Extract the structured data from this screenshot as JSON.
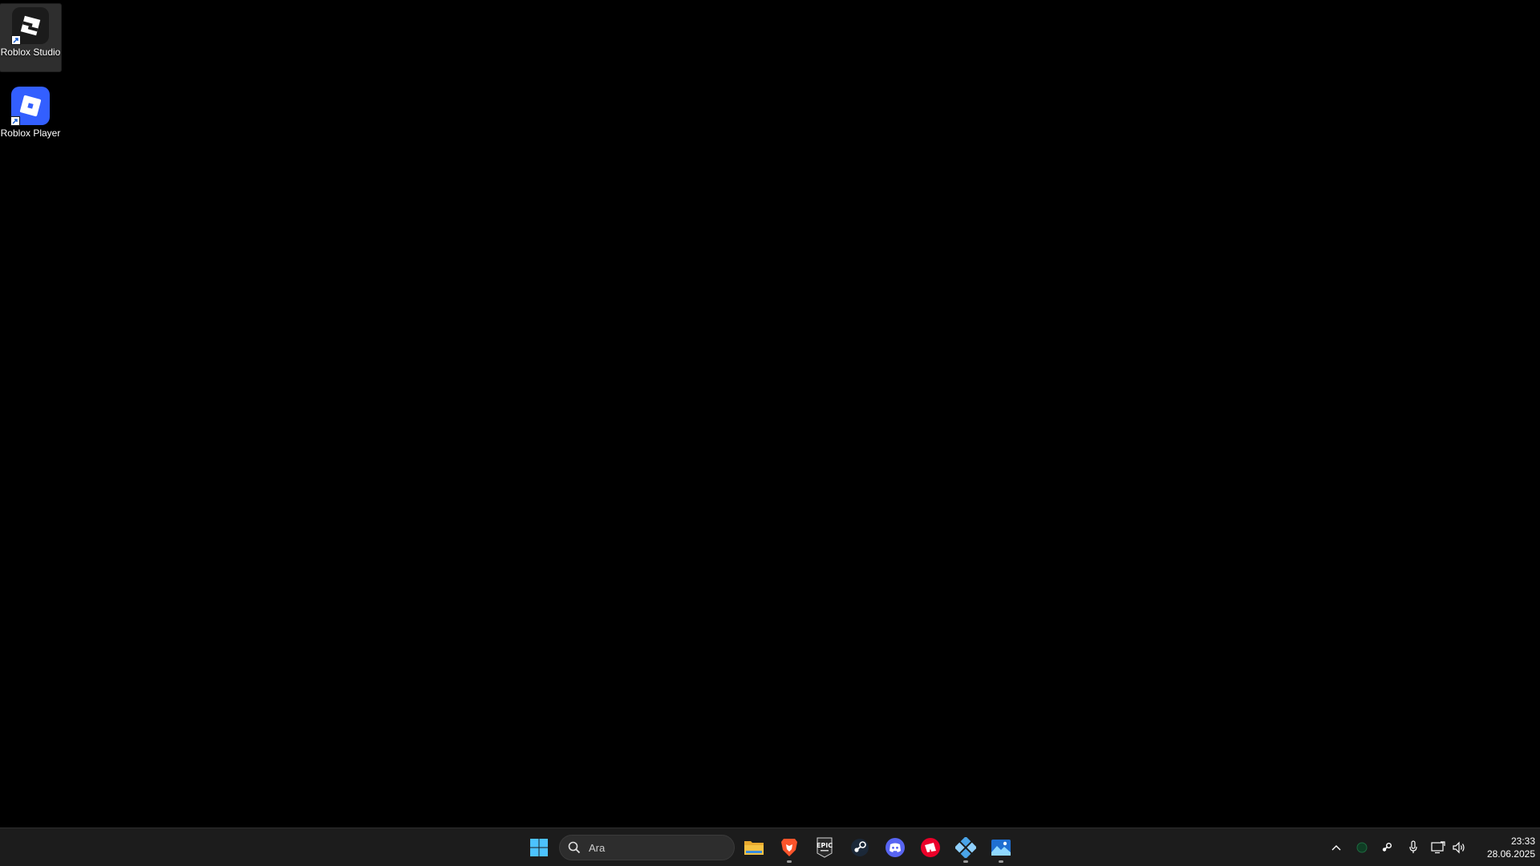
{
  "desktop": {
    "background": "#000000",
    "icons": [
      {
        "label": "Roblox Studio",
        "icon": "roblox-studio-icon",
        "selected": true
      },
      {
        "label": "Roblox Player",
        "icon": "roblox-player-icon",
        "selected": false
      }
    ]
  },
  "taskbar": {
    "background": "#1c1c1c",
    "start_icon": "windows-logo-icon",
    "search": {
      "placeholder": "Ara",
      "icon": "search-icon"
    },
    "pinned": [
      {
        "name": "File Explorer",
        "icon": "folder-icon",
        "running": false
      },
      {
        "name": "Brave",
        "icon": "brave-lion-icon",
        "running": true
      },
      {
        "name": "Epic Games Launcher",
        "icon": "epic-games-icon",
        "running": false
      },
      {
        "name": "Steam",
        "icon": "steam-icon",
        "running": false
      },
      {
        "name": "Discord",
        "icon": "discord-icon",
        "running": false
      },
      {
        "name": "Riot Client",
        "icon": "riot-icon",
        "running": false
      },
      {
        "name": "Roblox Studio",
        "icon": "roblox-studio-icon",
        "running": true
      },
      {
        "name": "Photos",
        "icon": "image-icon",
        "running": true
      }
    ],
    "tray": {
      "icons": [
        "chevron-up-icon",
        "status-dot-icon",
        "steam-tray-icon",
        "microphone-icon",
        "network-icon",
        "volume-icon"
      ]
    },
    "clock": {
      "time": "23:33",
      "date": "28.06.2025"
    }
  },
  "colors": {
    "accent_blue": "#3d7bff",
    "windows_blue": "#4cc2ff",
    "folder_yellow": "#f5c242",
    "brave_orange": "#fb542b",
    "discord_blurple": "#5865f2",
    "riot_red": "#eb0029"
  }
}
